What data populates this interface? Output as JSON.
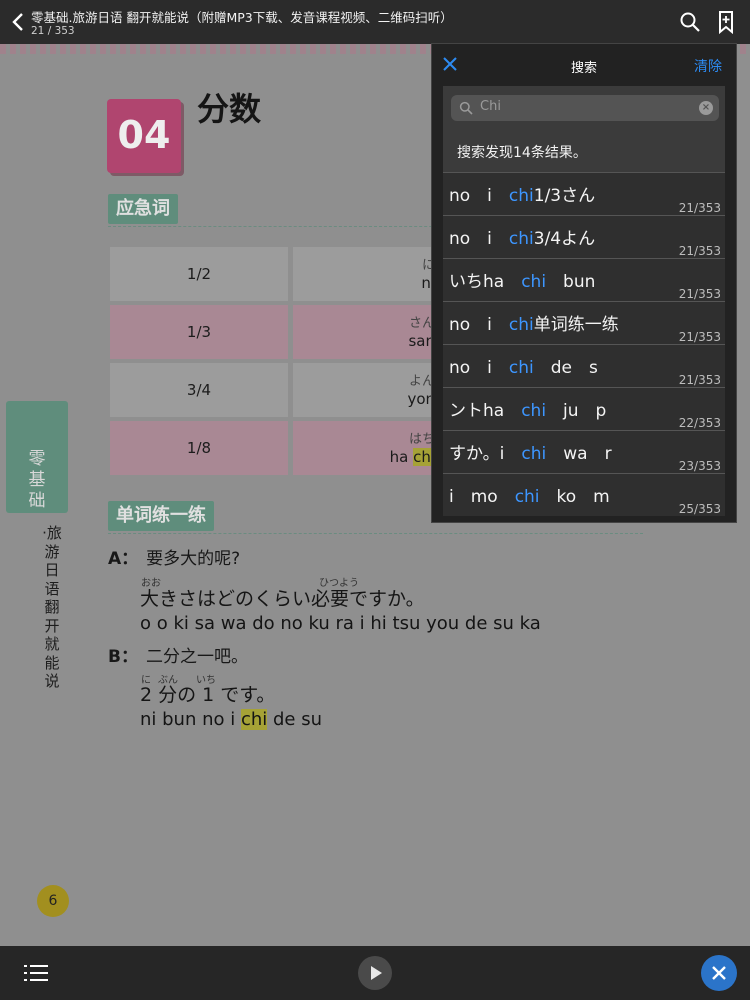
{
  "topbar": {
    "title": "零基础.旅游日语 翻开就能说（附赠MP3下载、发音课程视频、二维码扫听）",
    "page_indicator": "21 / 353"
  },
  "page": {
    "lesson_number": "04",
    "lesson_title": "分数",
    "section_vocab": "应急词",
    "section_practice": "单词练一练",
    "table": [
      {
        "fraction": "1/2",
        "kana": "に",
        "romaji": "ni",
        "highlight": ""
      },
      {
        "fraction": "1/3",
        "kana": "さん",
        "romaji": "san",
        "highlight": ""
      },
      {
        "fraction": "3/4",
        "kana": "よん",
        "romaji": "yon",
        "highlight": ""
      },
      {
        "fraction": "1/8",
        "kana": "はち",
        "romaji": "ha ",
        "highlight": "chi"
      }
    ],
    "side_tab": "零基础",
    "side_text": "·旅游日语 翻开就能说",
    "dialog": {
      "a_label": "A：",
      "a_text": "要多大的呢?",
      "a_ruby1": "おお",
      "a_ruby2": "ひつよう",
      "a_jp": "大きさはどのくらい必要ですか。",
      "a_romaji": "o o ki sa wa do no ku ra i hi tsu you de su ka",
      "b_label": "B：",
      "b_text": "二分之一吧。",
      "b_ruby1": "に",
      "b_ruby2": "ぶん",
      "b_ruby3": "いち",
      "b_jp": "2 分の 1 です。",
      "b_romaji_pre": "ni bun no i ",
      "b_romaji_hl": "chi",
      "b_romaji_post": " de su"
    },
    "page_number": "6"
  },
  "search": {
    "title": "搜索",
    "clear_label": "清除",
    "query": "Chi",
    "result_count": "搜索发现14条结果。",
    "results": [
      {
        "pre": "no　i　",
        "match": "chi",
        "post": "1/3さん",
        "page": "21/353"
      },
      {
        "pre": "no　i　",
        "match": "chi",
        "post": "3/4よん",
        "page": "21/353"
      },
      {
        "pre": "いちha　",
        "match": "chi",
        "post": "　bun",
        "page": "21/353"
      },
      {
        "pre": "no　i　",
        "match": "chi",
        "post": "单词练一练",
        "page": "21/353"
      },
      {
        "pre": "no　i　",
        "match": "chi",
        "post": "　de　s",
        "page": "21/353"
      },
      {
        "pre": "ントha　",
        "match": "chi",
        "post": "　ju　p",
        "page": "22/353"
      },
      {
        "pre": "すか。i　",
        "match": "chi",
        "post": "　wa　r",
        "page": "23/353"
      },
      {
        "pre": "i　mo　",
        "match": "chi",
        "post": "　ko　m",
        "page": "25/353"
      }
    ]
  },
  "icons": {
    "back": "chevron-left-icon",
    "search": "search-icon",
    "bookmark": "bookmark-add-icon",
    "close": "close-icon",
    "toc": "list-icon",
    "play": "play-icon",
    "exit": "close-circle-icon"
  },
  "colors": {
    "accent_blue": "#3d96ff",
    "clear_blue": "#2d8bf2",
    "exit_button": "#2b74c9",
    "panel_bg": "#222222",
    "badge_pink": "#b0456f",
    "section_green": "#5f8d7c"
  }
}
